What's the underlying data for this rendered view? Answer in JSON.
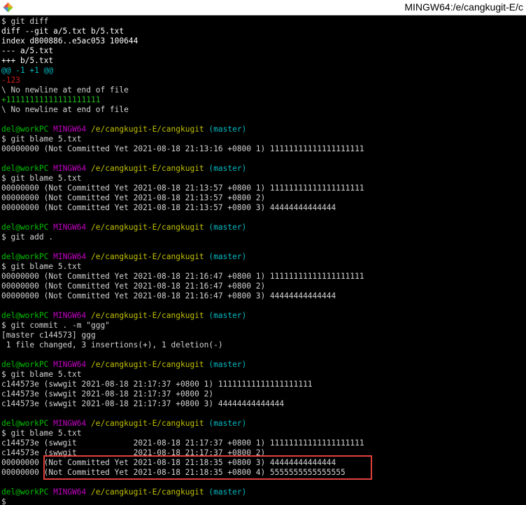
{
  "window": {
    "title": "MINGW64:/e/cangkugit-E/c",
    "icon": "git-bash-icon"
  },
  "colors": {
    "background": "#000000",
    "text": "#d4d4d4",
    "user": "#00c000",
    "mingw": "#bf00bf",
    "path": "#c0c000",
    "branch": "#00b8c0",
    "removed": "#d01c1c",
    "added": "#20c020",
    "hunk": "#00b8c0",
    "highlight_box": "#e0403c"
  },
  "lines": [
    {
      "kind": "plain",
      "text": "$ git diff"
    },
    {
      "kind": "bold",
      "text": "diff --git a/5.txt b/5.txt"
    },
    {
      "kind": "bold",
      "text": "index d800886..e5ac053 100644"
    },
    {
      "kind": "bold",
      "text": "--- a/5.txt"
    },
    {
      "kind": "bold",
      "text": "+++ b/5.txt"
    },
    {
      "kind": "hunk",
      "text": "@@ -1 +1 @@"
    },
    {
      "kind": "removed",
      "text": "-123"
    },
    {
      "kind": "plain",
      "text": "\\ No newline at end of file"
    },
    {
      "kind": "added",
      "text": "+11111111111111111111"
    },
    {
      "kind": "plain",
      "text": "\\ No newline at end of file"
    },
    {
      "kind": "blank",
      "text": ""
    },
    {
      "kind": "prompt",
      "user": "del@workPC",
      "env": "MINGW64",
      "path": "/e/cangkugit-E/cangkugit",
      "branch": "(master)"
    },
    {
      "kind": "plain",
      "text": "$ git blame 5.txt"
    },
    {
      "kind": "plain",
      "text": "00000000 (Not Committed Yet 2021-08-18 21:13:16 +0800 1) 11111111111111111111"
    },
    {
      "kind": "blank",
      "text": ""
    },
    {
      "kind": "prompt",
      "user": "del@workPC",
      "env": "MINGW64",
      "path": "/e/cangkugit-E/cangkugit",
      "branch": "(master)"
    },
    {
      "kind": "plain",
      "text": "$ git blame 5.txt"
    },
    {
      "kind": "plain",
      "text": "00000000 (Not Committed Yet 2021-08-18 21:13:57 +0800 1) 11111111111111111111"
    },
    {
      "kind": "plain",
      "text": "00000000 (Not Committed Yet 2021-08-18 21:13:57 +0800 2)"
    },
    {
      "kind": "plain",
      "text": "00000000 (Not Committed Yet 2021-08-18 21:13:57 +0800 3) 44444444444444"
    },
    {
      "kind": "blank",
      "text": ""
    },
    {
      "kind": "prompt",
      "user": "del@workPC",
      "env": "MINGW64",
      "path": "/e/cangkugit-E/cangkugit",
      "branch": "(master)"
    },
    {
      "kind": "plain",
      "text": "$ git add ."
    },
    {
      "kind": "blank",
      "text": ""
    },
    {
      "kind": "prompt",
      "user": "del@workPC",
      "env": "MINGW64",
      "path": "/e/cangkugit-E/cangkugit",
      "branch": "(master)"
    },
    {
      "kind": "plain",
      "text": "$ git blame 5.txt"
    },
    {
      "kind": "plain",
      "text": "00000000 (Not Committed Yet 2021-08-18 21:16:47 +0800 1) 11111111111111111111"
    },
    {
      "kind": "plain",
      "text": "00000000 (Not Committed Yet 2021-08-18 21:16:47 +0800 2)"
    },
    {
      "kind": "plain",
      "text": "00000000 (Not Committed Yet 2021-08-18 21:16:47 +0800 3) 44444444444444"
    },
    {
      "kind": "blank",
      "text": ""
    },
    {
      "kind": "prompt",
      "user": "del@workPC",
      "env": "MINGW64",
      "path": "/e/cangkugit-E/cangkugit",
      "branch": "(master)"
    },
    {
      "kind": "plain",
      "text": "$ git commit . -m \"ggg\""
    },
    {
      "kind": "plain",
      "text": "[master c144573] ggg"
    },
    {
      "kind": "plain",
      "text": " 1 file changed, 3 insertions(+), 1 deletion(-)"
    },
    {
      "kind": "blank",
      "text": ""
    },
    {
      "kind": "prompt",
      "user": "del@workPC",
      "env": "MINGW64",
      "path": "/e/cangkugit-E/cangkugit",
      "branch": "(master)"
    },
    {
      "kind": "plain",
      "text": "$ git blame 5.txt"
    },
    {
      "kind": "plain",
      "text": "c144573e (swwgit 2021-08-18 21:17:37 +0800 1) 11111111111111111111"
    },
    {
      "kind": "plain",
      "text": "c144573e (swwgit 2021-08-18 21:17:37 +0800 2)"
    },
    {
      "kind": "plain",
      "text": "c144573e (swwgit 2021-08-18 21:17:37 +0800 3) 44444444444444"
    },
    {
      "kind": "blank",
      "text": ""
    },
    {
      "kind": "prompt",
      "user": "del@workPC",
      "env": "MINGW64",
      "path": "/e/cangkugit-E/cangkugit",
      "branch": "(master)"
    },
    {
      "kind": "plain",
      "text": "$ git blame 5.txt"
    },
    {
      "kind": "plain",
      "text": "c144573e (swwgit            2021-08-18 21:17:37 +0800 1) 11111111111111111111"
    },
    {
      "kind": "plain",
      "text": "c144573e (swwgit            2021-08-18 21:17:37 +0800 2)"
    },
    {
      "kind": "plain",
      "text": "00000000 (Not Committed Yet 2021-08-18 21:18:35 +0800 3) 44444444444444"
    },
    {
      "kind": "plain",
      "text": "00000000 (Not Committed Yet 2021-08-18 21:18:35 +0800 4) 5555555555555555"
    },
    {
      "kind": "blank",
      "text": ""
    },
    {
      "kind": "prompt",
      "user": "del@workPC",
      "env": "MINGW64",
      "path": "/e/cangkugit-E/cangkugit",
      "branch": "(master)"
    },
    {
      "kind": "input",
      "text": "$"
    }
  ]
}
